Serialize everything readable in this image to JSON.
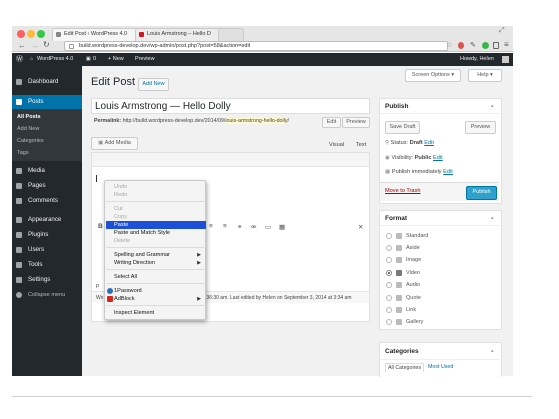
{
  "browser": {
    "tabs": [
      {
        "label": "Edit Post ‹ WordPress 4.0"
      },
      {
        "label": "Louis Armstrong – Hello D"
      }
    ],
    "url": "build.wordpress-develop.dev/wp-admin/post.php?post=58&action=edit"
  },
  "adminbar": {
    "site": "WordPress 4.0",
    "comments": "0",
    "new_label": "+ New",
    "preview": "Preview",
    "howdy": "Howdy, Helen"
  },
  "sidebar": {
    "dashboard": "Dashboard",
    "posts": "Posts",
    "subitems": [
      "All Posts",
      "Add New",
      "Categories",
      "Tags"
    ],
    "items": [
      "Media",
      "Pages",
      "Comments",
      "Appearance",
      "Plugins",
      "Users",
      "Tools",
      "Settings"
    ],
    "collapse": "Collapse menu"
  },
  "page": {
    "title": "Edit Post",
    "add_new": "Add New",
    "screen_options": "Screen Options",
    "help": "Help"
  },
  "post": {
    "title": "Louis Armstrong — Hello Dolly",
    "permalink_label": "Permalink:",
    "permalink_base": "http://build.wordpress-develop.dev/2014/09/",
    "permalink_slug": "louis-armstrong-hello-dolly",
    "permalink_end": "/",
    "edit": "Edit",
    "preview": "Preview",
    "add_media": "Add Media",
    "tab_visual": "Visual",
    "tab_text": "Text",
    "footer_word": "Wo",
    "footer_last_edited": ":36:30 am. Last edited by Helen on September 3, 2014 at 3:34 am",
    "path": "p"
  },
  "publish": {
    "header": "Publish",
    "save_draft": "Save Draft",
    "preview": "Preview",
    "status_label": "Status:",
    "status_value": "Draft",
    "visibility_label": "Visibility:",
    "visibility_value": "Public",
    "schedule": "Publish immediately",
    "edit": "Edit",
    "trash": "Move to Trash",
    "publish_btn": "Publish"
  },
  "format": {
    "header": "Format",
    "options": [
      "Standard",
      "Aside",
      "Image",
      "Video",
      "Audio",
      "Quote",
      "Link",
      "Gallery"
    ],
    "selected": "Video"
  },
  "categories": {
    "header": "Categories",
    "tab_all": "All Categories",
    "tab_most_used": "Most Used"
  },
  "context_menu": {
    "undo": "Undo",
    "redo": "Redo",
    "cut": "Cut",
    "copy": "Copy",
    "paste": "Paste",
    "paste_match": "Paste and Match Style",
    "delete": "Delete",
    "spelling": "Spelling and Grammar",
    "writing": "Writing Direction",
    "select_all": "Select All",
    "onepassword": "1Password",
    "adblock": "AdBlock",
    "inspect": "Inspect Element"
  },
  "colors": {
    "admin_dark": "#23282d",
    "active_blue": "#0073aa",
    "highlight": "#1e4fd8",
    "publish_blue": "#2ea2cc",
    "trash_red": "#a00"
  }
}
